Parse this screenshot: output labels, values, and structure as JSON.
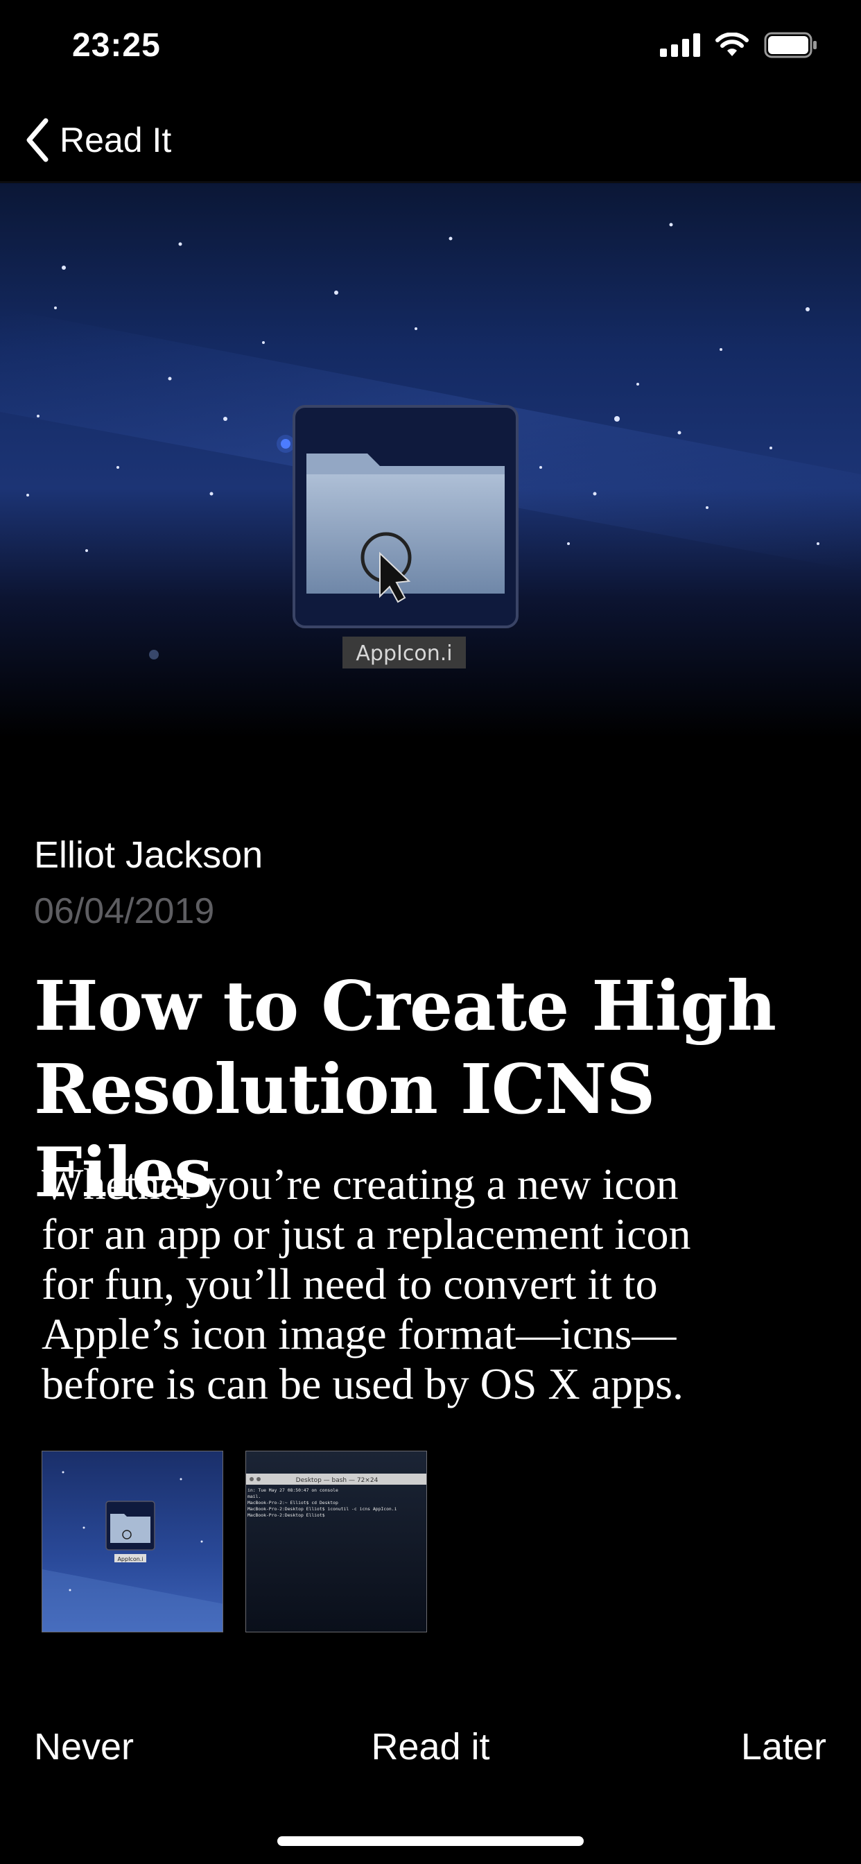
{
  "status_bar": {
    "time": "23:25",
    "icons": [
      "cellular-signal-icon",
      "wifi-icon",
      "battery-icon"
    ]
  },
  "nav": {
    "back_label": "Read It",
    "back_icon": "chevron-left-icon"
  },
  "hero": {
    "icon_label": "AppIcon.i",
    "icon_name": "folder-icon"
  },
  "article": {
    "author": "Elliot Jackson",
    "date": "06/04/2019",
    "title_line1": "How to Create High",
    "title_line2": "Resolution ICNS Files",
    "summary_lines": [
      "Whether you’re creating a new icon",
      "for an app or just a replacement icon",
      "for fun, you’ll need to convert it to",
      "Apple’s icon image format—icns—",
      "before is can be used by OS X apps."
    ]
  },
  "thumbnails": {
    "first": {
      "label": "AppIcon.i"
    },
    "second": {
      "window_title": "Desktop — bash — 72×24",
      "terminal_lines": [
        "in: Tue May 27 08:50:47 on console",
        "mail.",
        "MacBook-Pro-2:~ Elliot$ cd Desktop",
        "MacBook-Pro-2:Desktop Elliot$ iconutil -c icns AppIcon.i",
        "MacBook-Pro-2:Desktop Elliot$"
      ]
    }
  },
  "actions": {
    "never": "Never",
    "read": "Read it",
    "later": "Later"
  },
  "colors": {
    "background": "#000000",
    "text": "#ffffff",
    "secondary_text": "#5e5e62",
    "hero_sky_top": "#0b1736",
    "hero_sky_band": "#1c3475"
  }
}
